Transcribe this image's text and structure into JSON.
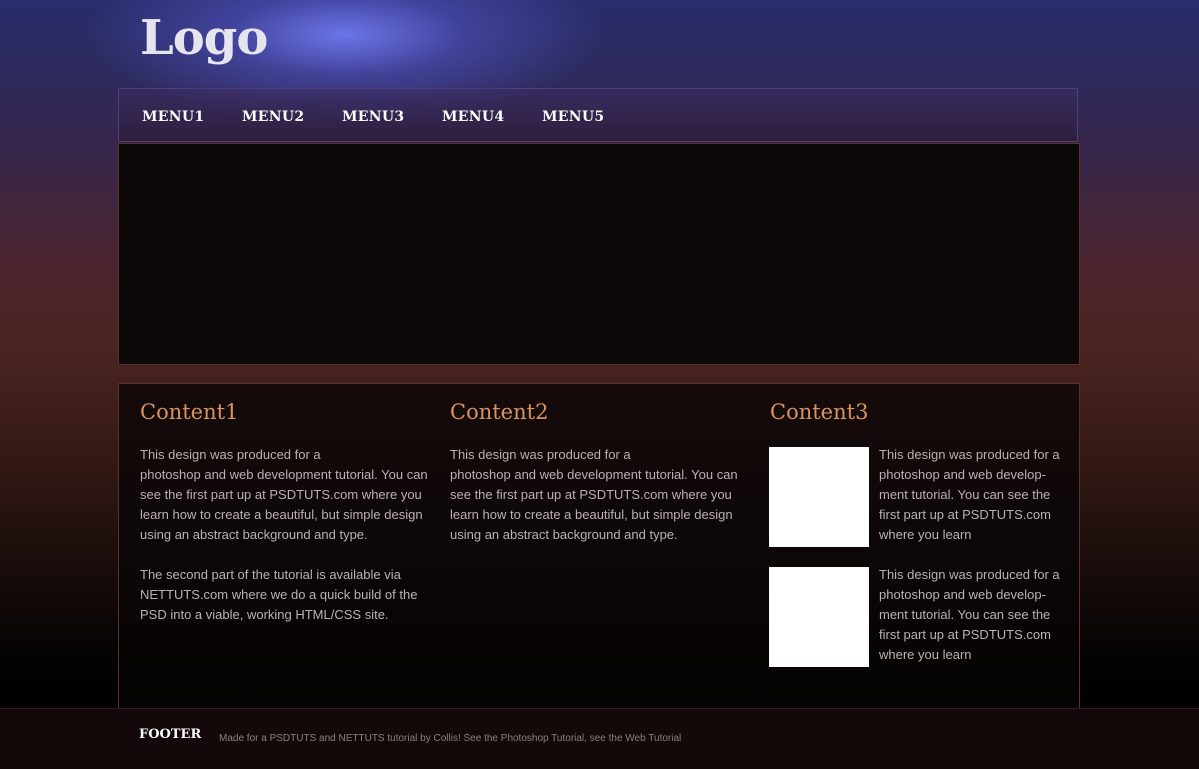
{
  "header": {
    "logo": "Logo"
  },
  "nav": {
    "items": [
      "MENU1",
      "MENU2",
      "MENU3",
      "MENU4",
      "MENU5"
    ]
  },
  "columns": [
    {
      "title": "Content1",
      "paragraphs": [
        "This design was produced for a\nphotoshop and web development tutorial.  You can see the first part up at PSDTUTS.com where you learn how to create a beautiful, but simple design using an abstract background and type.",
        "The second part of the tutorial is available via NETTUTS.com where we do a quick build of the PSD into a viable, working HTML/CSS site."
      ]
    },
    {
      "title": "Content2",
      "paragraphs": [
        "This design was produced for a\nphotoshop and web development tutorial.  You can see the first part up at PSDTUTS.com where you learn how to create a beautiful, but simple design using an abstract background and type."
      ]
    },
    {
      "title": "Content3",
      "items": [
        {
          "text": "This design was produced for a photoshop and web develop-ment tutorial.  You can see the first part up at PSDTUTS.com where you learn"
        },
        {
          "text": "This design was produced for a photoshop and web develop-ment tutorial.  You can see the first part up at PSDTUTS.com where you learn"
        }
      ]
    }
  ],
  "footer": {
    "title": "FOOTER",
    "text": "Made for a PSDTUTS and NETTUTS tutorial by Collis!   See the Photoshop Tutorial, see the Web Tutorial"
  },
  "colors": {
    "heading": "#d9935c",
    "body_text": "#b9b2b0",
    "nav_border": "#4a3f78",
    "panel_border": "#5a2f2c"
  }
}
